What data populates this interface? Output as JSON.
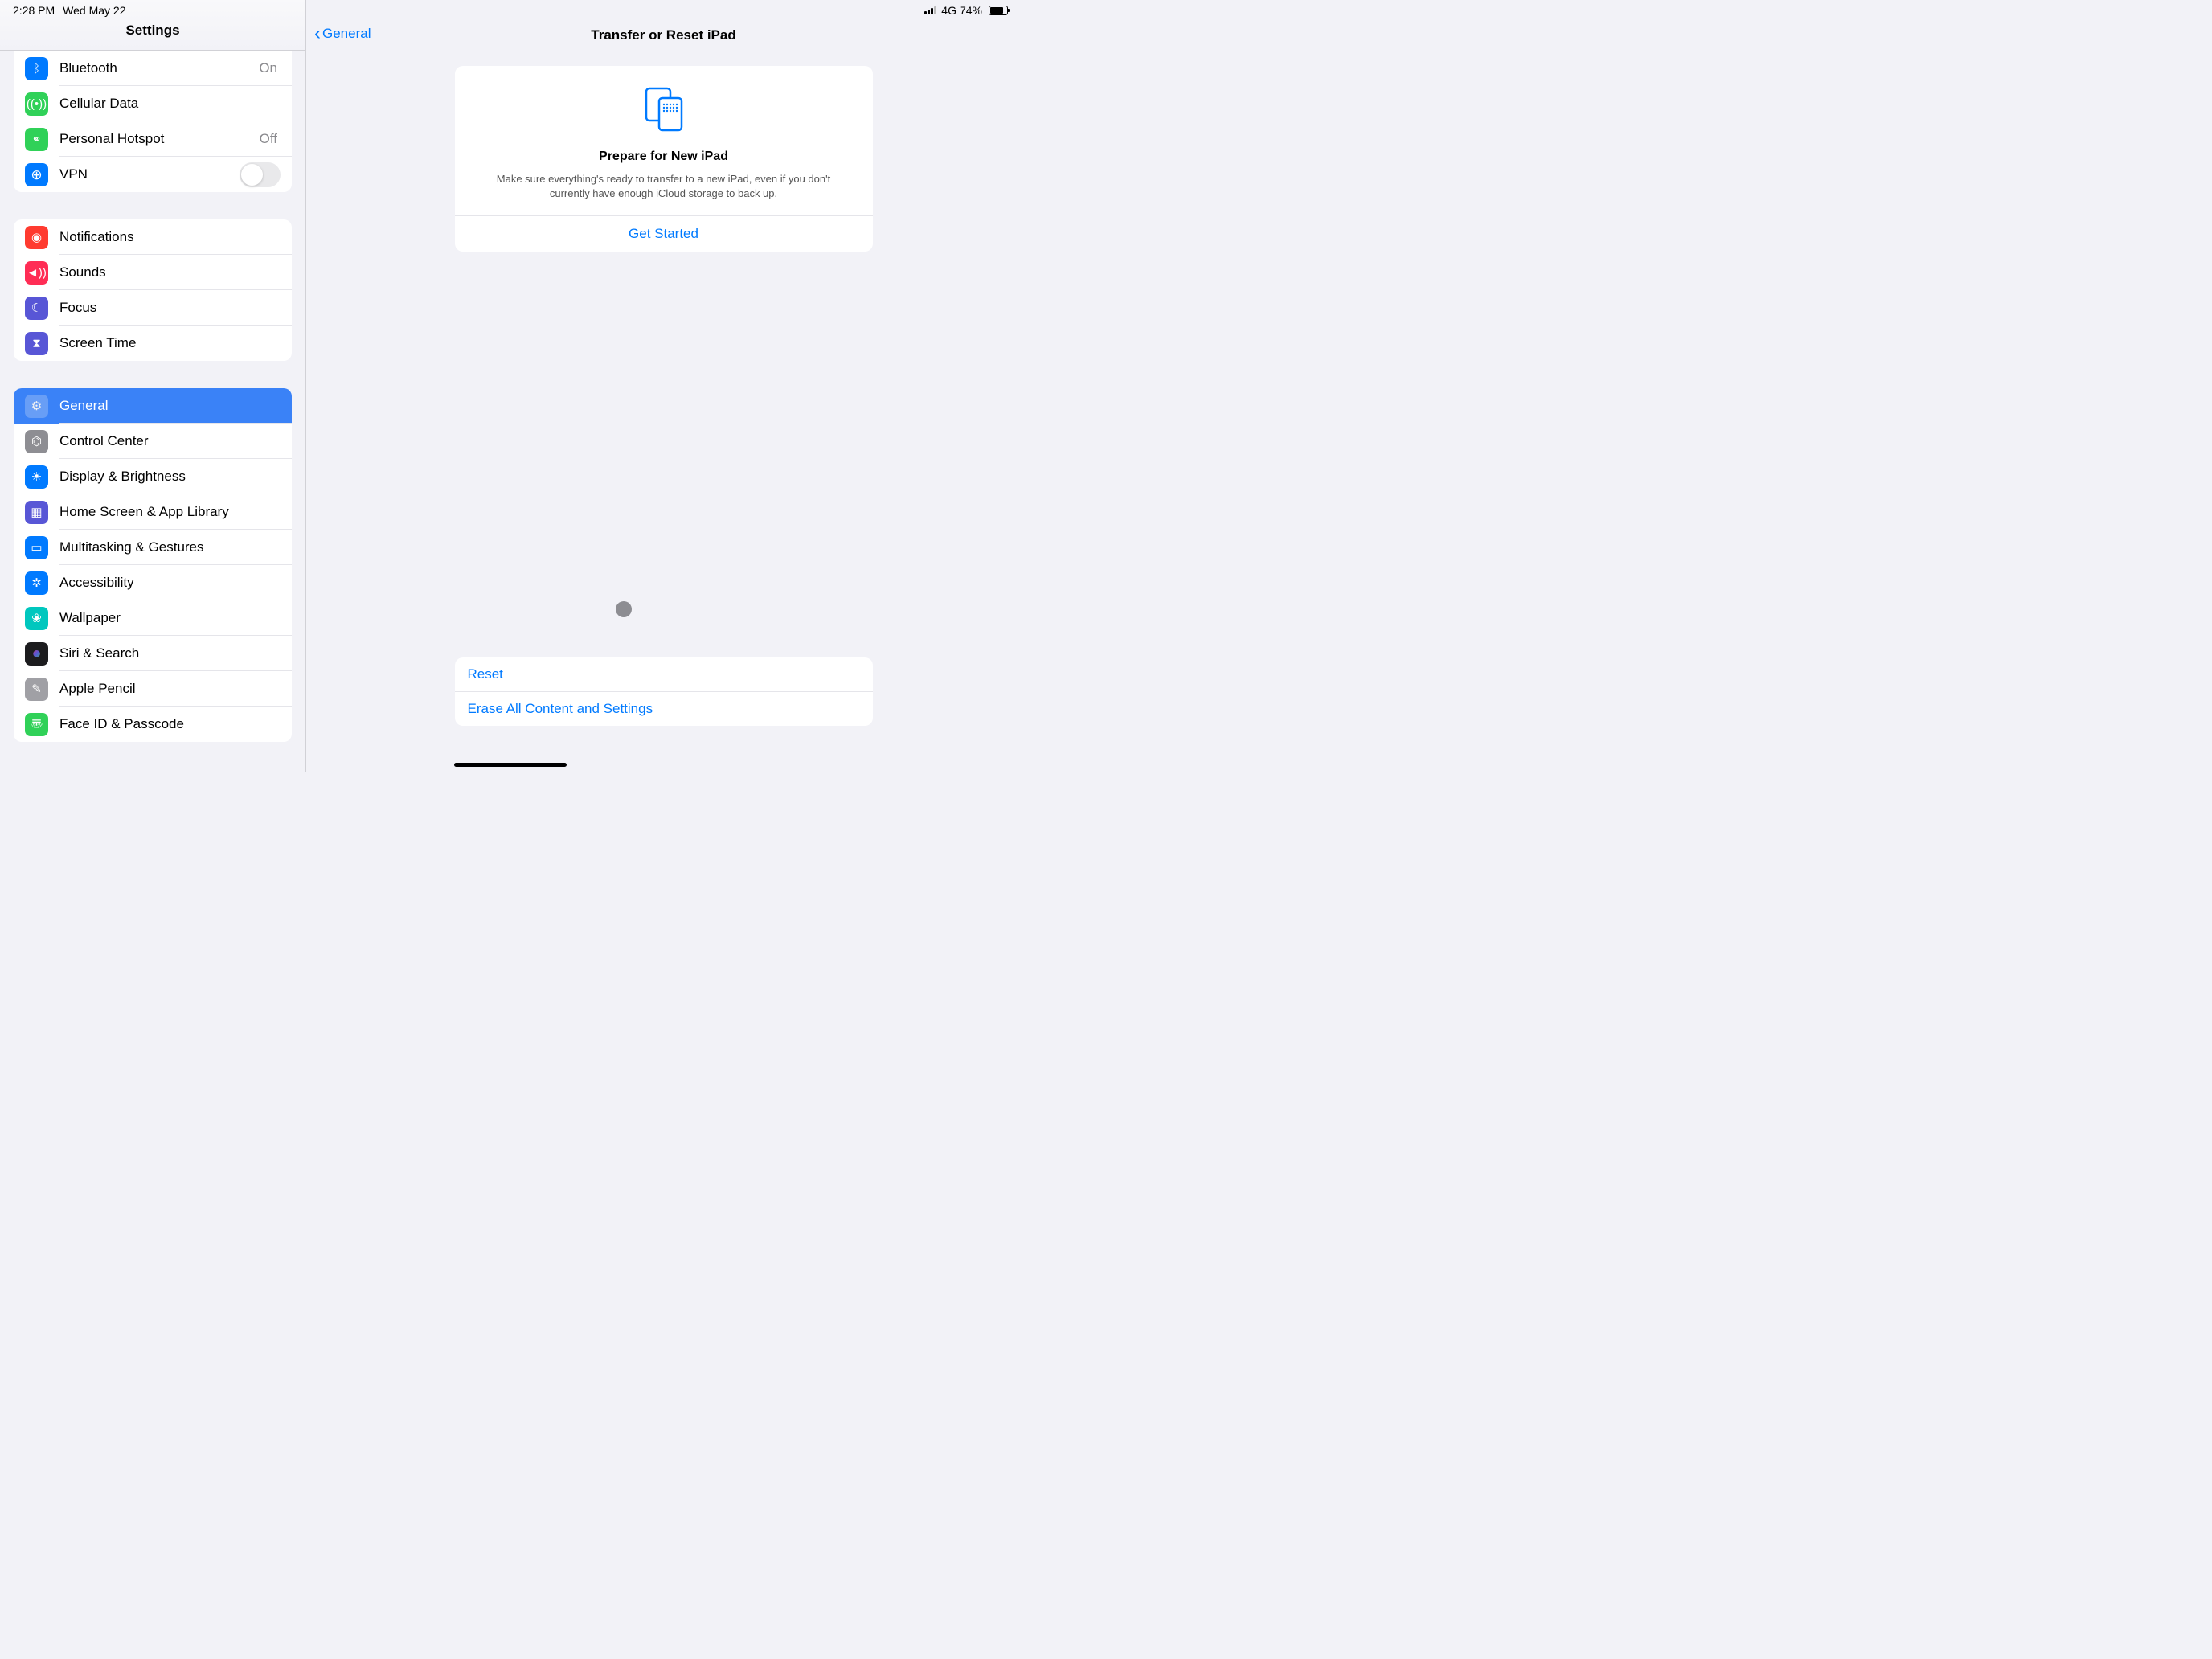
{
  "status": {
    "time": "2:28 PM",
    "date": "Wed May 22",
    "network": "4G",
    "battery_pct": "74%"
  },
  "sidebar": {
    "title": "Settings",
    "group1": [
      {
        "label": "Bluetooth",
        "value": "On",
        "icon": "bluetooth",
        "color": "bg-blue"
      },
      {
        "label": "Cellular Data",
        "value": "",
        "icon": "antenna",
        "color": "bg-green"
      },
      {
        "label": "Personal Hotspot",
        "value": "Off",
        "icon": "link",
        "color": "bg-green"
      },
      {
        "label": "VPN",
        "value": "",
        "icon": "globe",
        "color": "bg-blue",
        "toggle": true
      }
    ],
    "group2": [
      {
        "label": "Notifications",
        "icon": "bell",
        "color": "bg-red"
      },
      {
        "label": "Sounds",
        "icon": "speaker",
        "color": "bg-pink"
      },
      {
        "label": "Focus",
        "icon": "moon",
        "color": "bg-indigo"
      },
      {
        "label": "Screen Time",
        "icon": "hourglass",
        "color": "bg-indigo"
      }
    ],
    "group3": [
      {
        "label": "General",
        "icon": "gear",
        "color": "bg-gray",
        "selected": true
      },
      {
        "label": "Control Center",
        "icon": "switches",
        "color": "bg-gray"
      },
      {
        "label": "Display & Brightness",
        "icon": "sun",
        "color": "bg-blue"
      },
      {
        "label": "Home Screen & App Library",
        "icon": "grid",
        "color": "bg-indigo"
      },
      {
        "label": "Multitasking & Gestures",
        "icon": "rects",
        "color": "bg-blue"
      },
      {
        "label": "Accessibility",
        "icon": "person",
        "color": "bg-blue"
      },
      {
        "label": "Wallpaper",
        "icon": "flower",
        "color": "bg-teal"
      },
      {
        "label": "Siri & Search",
        "icon": "siri",
        "color": "bg-black"
      },
      {
        "label": "Apple Pencil",
        "icon": "pencil",
        "color": "bg-graylight"
      },
      {
        "label": "Face ID & Passcode",
        "icon": "faceid",
        "color": "bg-green"
      }
    ]
  },
  "detail": {
    "back_label": "General",
    "title": "Transfer or Reset iPad",
    "prepare": {
      "heading": "Prepare for New iPad",
      "body": "Make sure everything's ready to transfer to a new iPad, even if you don't currently have enough iCloud storage to back up.",
      "action": "Get Started"
    },
    "options": [
      "Reset",
      "Erase All Content and Settings"
    ]
  }
}
